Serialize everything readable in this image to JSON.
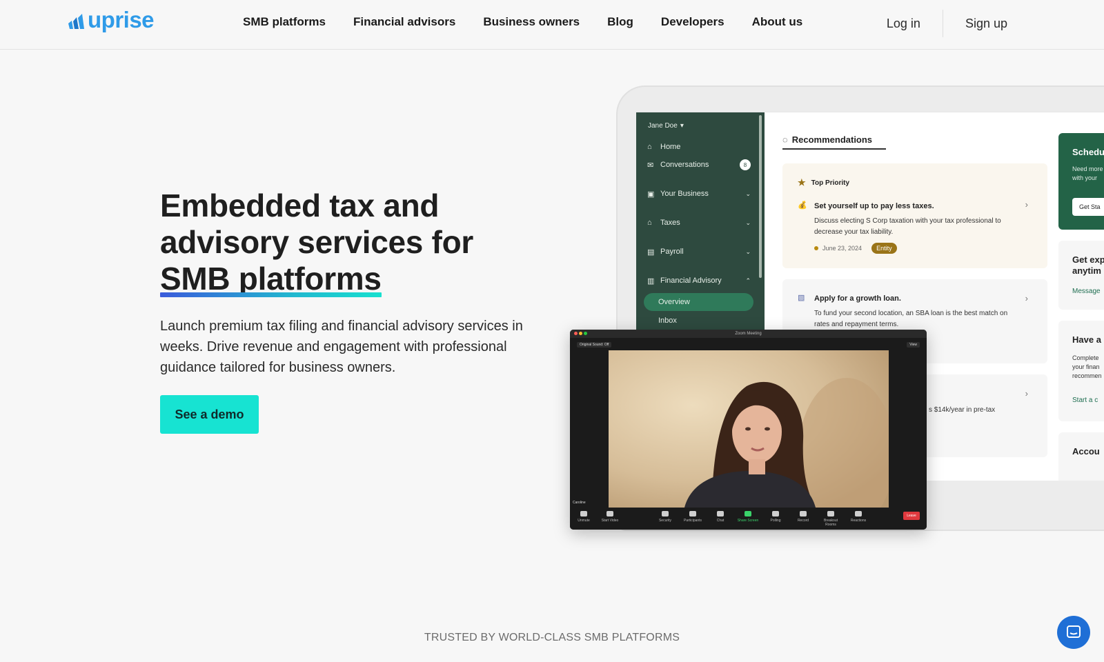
{
  "brand": {
    "name": "uprise",
    "color": "#2f9be8"
  },
  "nav": {
    "links": [
      "SMB platforms",
      "Financial advisors",
      "Business owners",
      "Blog",
      "Developers",
      "About us"
    ],
    "login": "Log in",
    "signup": "Sign up"
  },
  "hero": {
    "title_line1": "Embedded tax and",
    "title_line2": "advisory services for",
    "title_highlight": "SMB platforms",
    "subtitle": "Launch premium tax filing and financial advisory services in weeks. Drive revenue and engagement with professional guidance tailored for business owners.",
    "cta": "See a demo",
    "cta_color": "#17e3d2"
  },
  "app": {
    "user": "Jane Doe",
    "sidebar": [
      {
        "label": "Home",
        "icon": "home-icon"
      },
      {
        "label": "Conversations",
        "icon": "inbox-icon",
        "badge": "8"
      },
      {
        "label": "Your Business",
        "icon": "briefcase-icon"
      },
      {
        "label": "Taxes",
        "icon": "bank-icon"
      },
      {
        "label": "Payroll",
        "icon": "payroll-icon"
      },
      {
        "label": "Financial Advisory",
        "icon": "chart-icon"
      }
    ],
    "subitems": [
      "Overview",
      "Inbox"
    ],
    "tab": "Recommendations",
    "cards": [
      {
        "priority": "Top Priority",
        "title": "Set yourself up to pay less taxes.",
        "desc": "Discuss electing S Corp taxation with your tax professional to decrease your tax liability.",
        "date": "June 23, 2024",
        "tag": "Entity"
      },
      {
        "title": "Apply for a growth loan.",
        "desc": "To fund your second location, an SBA loan is the best match on rates and repayment terms."
      },
      {
        "desc": "s $14k/year in pre-tax"
      }
    ],
    "right": {
      "schedule_title": "Schedu",
      "schedule_text": [
        "Need more",
        "with your"
      ],
      "schedule_button": "Get Sta",
      "expert_title": [
        "Get exp",
        "anytim"
      ],
      "expert_link": "Message",
      "have_title": "Have a",
      "have_text": [
        "Complete",
        "your finan",
        "recommen"
      ],
      "have_link": "Start a c",
      "account_title": "Accou"
    }
  },
  "zoom": {
    "window_title": "Zoom Meeting",
    "original_sound": "Original Sound: Off",
    "view": "View",
    "participant": "Caroline",
    "controls": [
      "Unmute",
      "Start Video",
      "Security",
      "Participants",
      "Chat",
      "Share Screen",
      "Polling",
      "Record",
      "Breakout Rooms",
      "Reactions"
    ],
    "leave": "Leave"
  },
  "trusted": "TRUSTED BY WORLD-CLASS SMB PLATFORMS"
}
